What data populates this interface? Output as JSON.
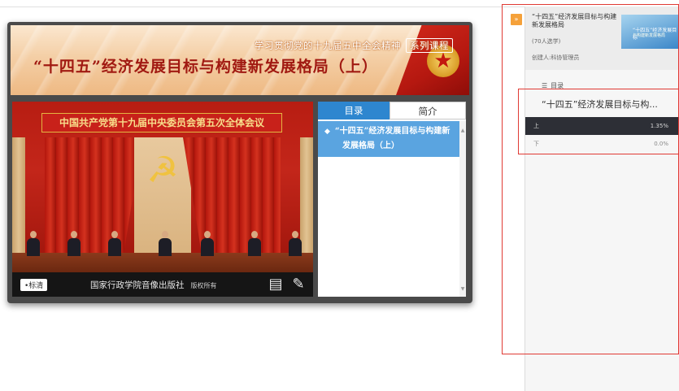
{
  "banner": {
    "subtitle": "学习贯彻党的十九届五中全会精神",
    "series_tag": "系列课程",
    "title": "“十四五”经济发展目标与构建新发展格局（上）"
  },
  "video": {
    "stage_banner": "中国共产党第十九届中央委员会第五次全体会议",
    "logo_label": "•标清",
    "publisher": "国家行政学院音像出版社",
    "rights": "版权所有"
  },
  "toc_panel": {
    "tabs": [
      {
        "label": "目录"
      },
      {
        "label": "简介"
      }
    ],
    "items": [
      {
        "line1": "“十四五”经济发展目标与构建新",
        "line2": "发展格局（上）"
      }
    ]
  },
  "sidebar": {
    "collapse_label": "»",
    "course_title": "“十四五”经济发展目标与构建新发展格局",
    "learners": "(70人选学)",
    "creator": "创建人:科协管理员",
    "thumb_line1": "“十四五”经济发展目标",
    "thumb_line2": "与构建新发展格局",
    "toc_header": "目录",
    "current_title": "“十四五”经济发展目标与构...",
    "lessons": [
      {
        "name": "上",
        "percent": "1.35%",
        "progress": 1.35
      },
      {
        "name": "下",
        "percent": "0.0%",
        "progress": 0.0
      }
    ]
  },
  "colors": {
    "accent_blue": "#2e86cf",
    "annotation_red": "#e03a34",
    "collapse_orange": "#f5a13a",
    "title_red": "#a11a12"
  },
  "icons": [
    "hammer-sickle-icon",
    "notes-icon",
    "edit-icon",
    "menu-icon",
    "graduation-cap-icon",
    "chevron-right-icon"
  ]
}
